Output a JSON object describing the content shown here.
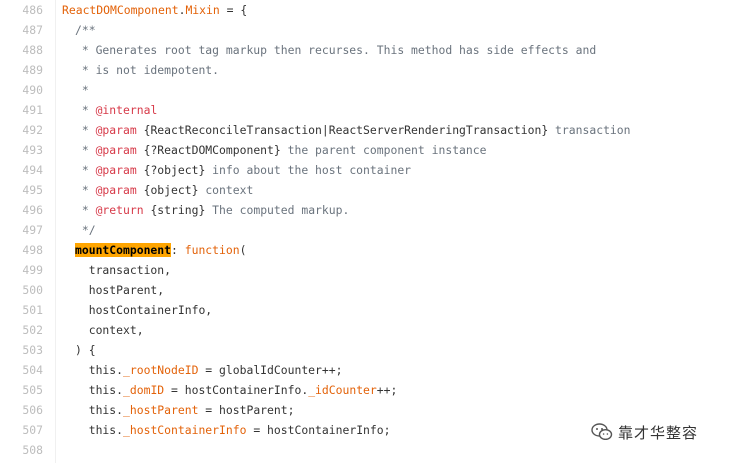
{
  "line_numbers": [
    "486",
    "487",
    "488",
    "489",
    "490",
    "491",
    "492",
    "493",
    "494",
    "495",
    "496",
    "497",
    "498",
    "499",
    "500",
    "501",
    "502",
    "503",
    "504",
    "505",
    "506",
    "507",
    "508"
  ],
  "code": {
    "l486": {
      "obj": "ReactDOMComponent",
      "dot": ".",
      "prop": "Mixin",
      "rest": " = {"
    },
    "l487": "/**",
    "l488": " * Generates root tag markup then recurses. This method has side effects and",
    "l489": " * is not idempotent.",
    "l490": " *",
    "l491": {
      "pre": " * ",
      "tag": "@internal"
    },
    "l492": {
      "pre": " * ",
      "tag": "@param",
      "type": " {ReactReconcileTransaction|ReactServerRenderingTransaction}",
      "name": " transaction"
    },
    "l493": {
      "pre": " * ",
      "tag": "@param",
      "type": " {?ReactDOMComponent}",
      "name": " the parent component instance"
    },
    "l494": {
      "pre": " * ",
      "tag": "@param",
      "type": " {?object}",
      "name": " info about the host container"
    },
    "l495": {
      "pre": " * ",
      "tag": "@param",
      "type": " {object}",
      "name": " context"
    },
    "l496": {
      "pre": " * ",
      "tag": "@return",
      "type": " {string}",
      "name": " The computed markup."
    },
    "l497": " */",
    "l498": {
      "fn": "mountComponent",
      "colon": ": ",
      "kw": "function",
      "paren": "("
    },
    "l499": "  transaction,",
    "l500": "  hostParent,",
    "l501": "  hostContainerInfo,",
    "l502": "  context,",
    "l503": ") {",
    "l504": {
      "a": "  this.",
      "b": "_rootNodeID",
      "c": " = globalIdCounter++;"
    },
    "l505": {
      "a": "  this.",
      "b": "_domID",
      "c": " = hostContainerInfo.",
      "d": "_idCounter",
      "e": "++;"
    },
    "l506": {
      "a": "  this.",
      "b": "_hostParent",
      "c": " = hostParent;"
    },
    "l507": {
      "a": "  this.",
      "b": "_hostContainerInfo",
      "c": " = hostContainerInfo;"
    }
  },
  "watermark": {
    "text": "靠才华整容",
    "icon": "wechat-icon"
  },
  "colors": {
    "keyword": "#e36209",
    "comment": "#6a737d",
    "jsdoc_tag": "#d73a49",
    "highlight": "#ffa500"
  }
}
